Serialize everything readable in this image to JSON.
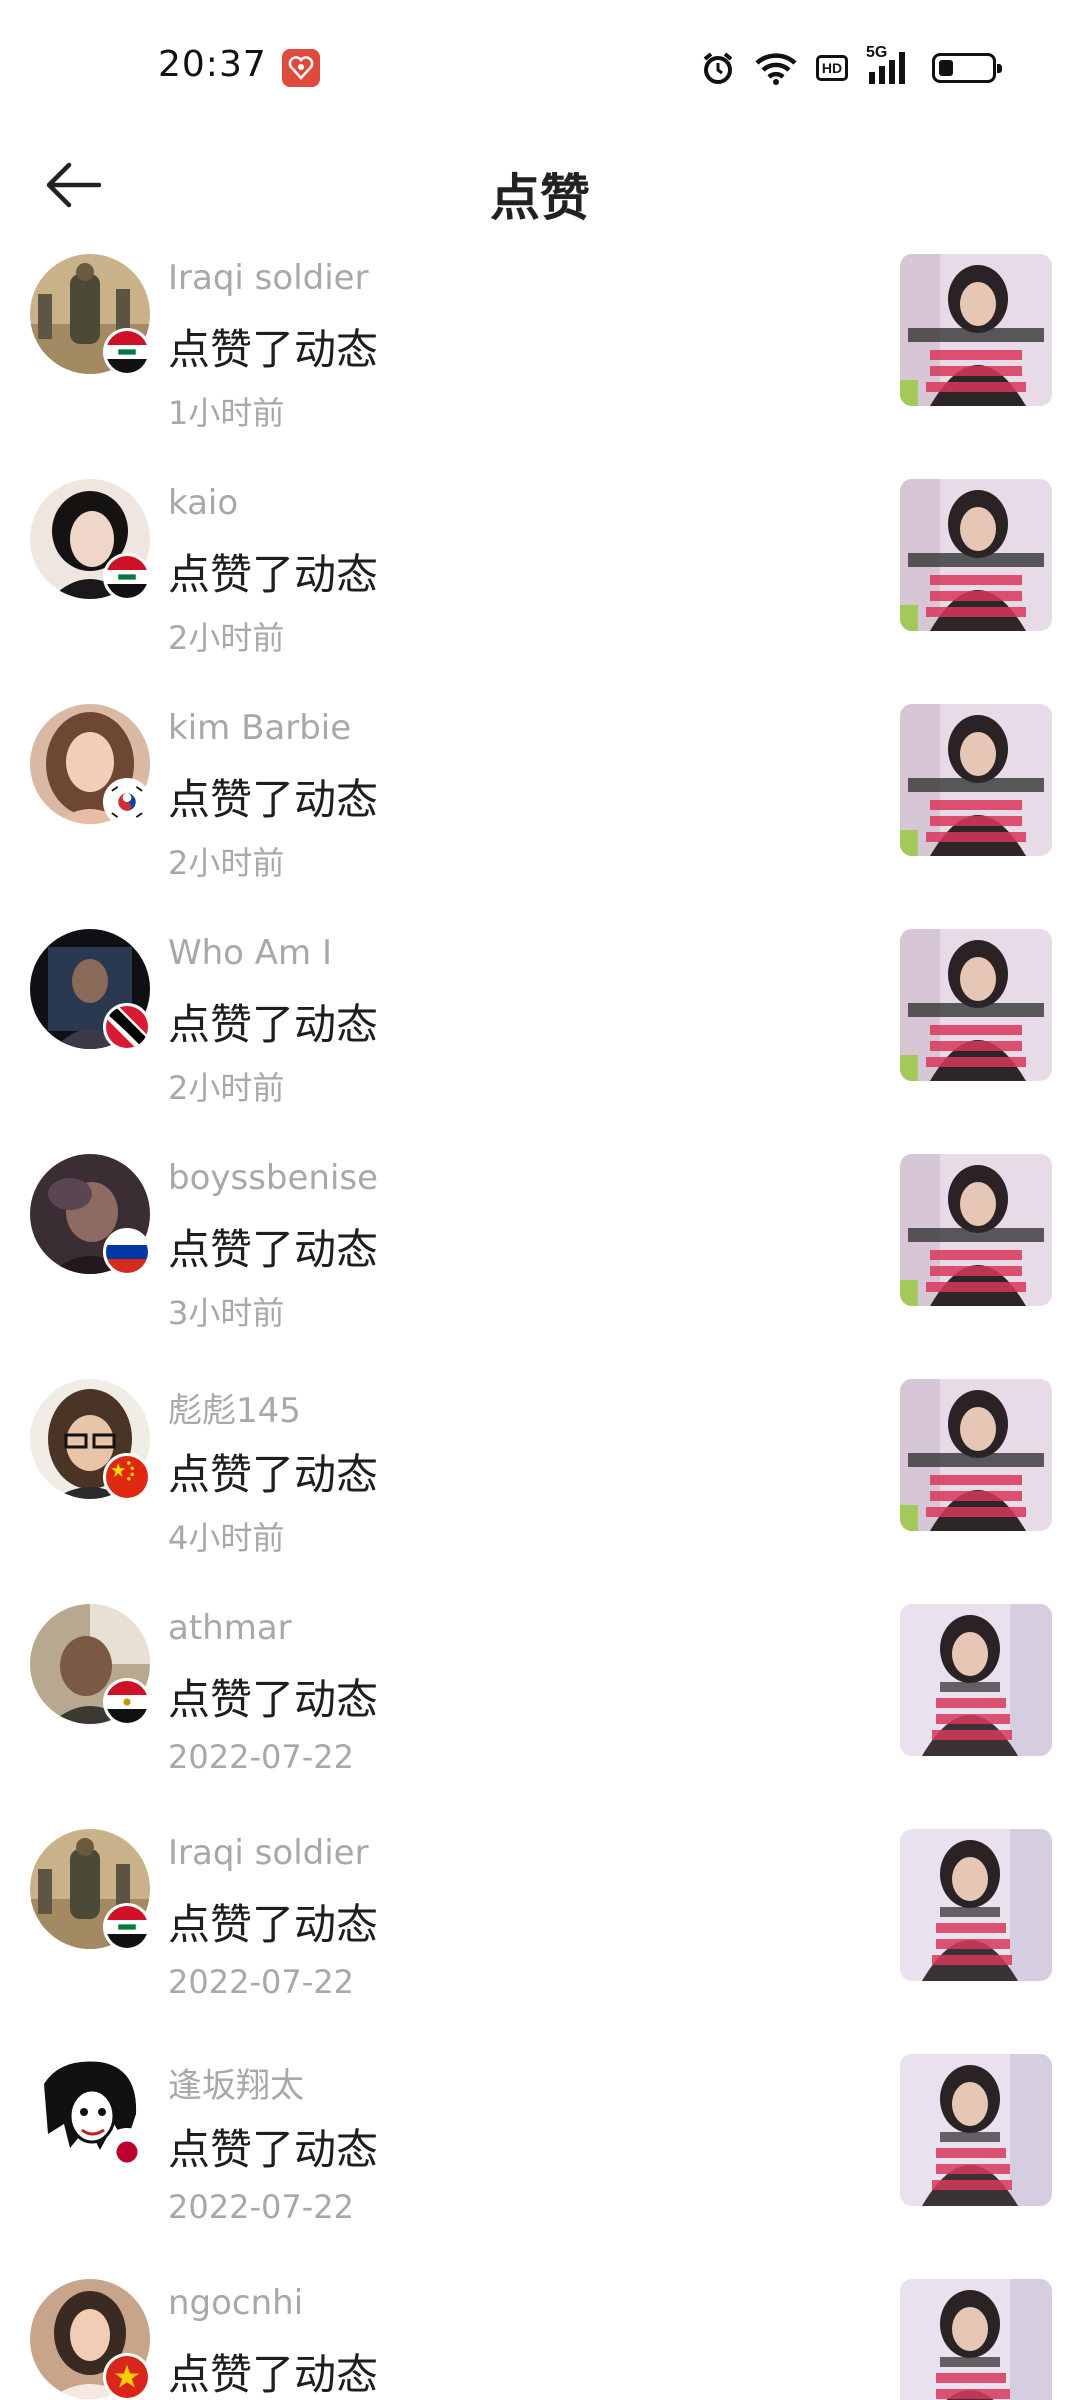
{
  "status_bar": {
    "time": "20:37",
    "icons": [
      "app-notification-icon",
      "alarm-icon",
      "wifi-icon",
      "hd-icon",
      "5g-signal-icon",
      "battery-icon"
    ],
    "hd_label": "HD",
    "network_label": "5G"
  },
  "header": {
    "back_icon": "arrow-left-icon",
    "title": "点赞"
  },
  "likes": [
    {
      "username": "Iraqi soldier",
      "action": "点赞了动态",
      "time": "1小时前",
      "flag": "iraq"
    },
    {
      "username": "kaio",
      "action": "点赞了动态",
      "time": "2小时前",
      "flag": "iraq"
    },
    {
      "username": "kim Barbie",
      "action": "点赞了动态",
      "time": "2小时前",
      "flag": "south-korea"
    },
    {
      "username": "Who Am I",
      "action": "点赞了动态",
      "time": "2小时前",
      "flag": "trinidad-and-tobago"
    },
    {
      "username": "boyssbenise",
      "action": "点赞了动态",
      "time": "3小时前",
      "flag": "russia"
    },
    {
      "username": "彪彪145",
      "action": "点赞了动态",
      "time": "4小时前",
      "flag": "china"
    },
    {
      "username": "athmar",
      "action": "点赞了动态",
      "time": "2022-07-22",
      "flag": "egypt"
    },
    {
      "username": "Iraqi soldier",
      "action": "点赞了动态",
      "time": "2022-07-22",
      "flag": "iraq"
    },
    {
      "username": "逢坂翔太",
      "action": "点赞了动态",
      "time": "2022-07-22",
      "flag": "japan"
    },
    {
      "username": "ngocnhi",
      "action": "点赞了动态",
      "time": "",
      "flag": "vietnam"
    }
  ],
  "colors": {
    "username": "#a8a8a8",
    "action": "#1e1e1e",
    "time": "#a8a8a8",
    "background": "#ffffff"
  }
}
